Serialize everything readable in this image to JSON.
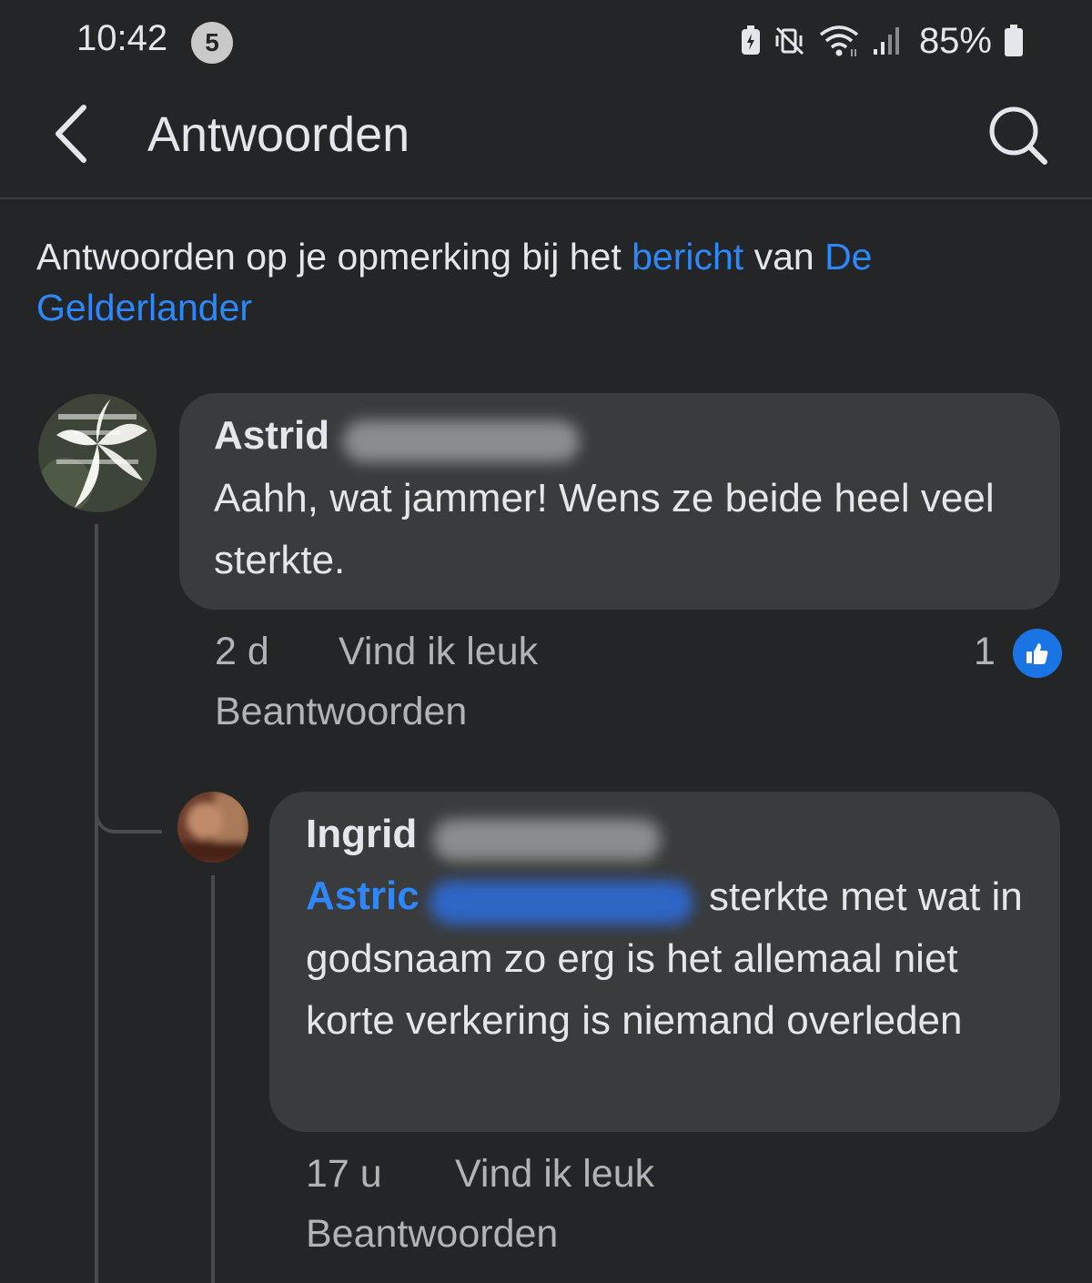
{
  "status_bar": {
    "time": "10:42",
    "notification_count": "5",
    "battery_percent": "85%"
  },
  "header": {
    "title": "Antwoorden"
  },
  "intro": {
    "text_before": "Antwoorden op je opmerking bij het ",
    "link_post": "bericht",
    "text_middle": " van ",
    "link_page": "De Gelderlander"
  },
  "comments": [
    {
      "author_first": "Astrid",
      "text": "Aahh, wat jammer! Wens ze beide heel veel sterkte.",
      "age": "2 d",
      "like_label": "Vind ik leuk",
      "reply_label": "Beantwoorden",
      "like_count": "1",
      "avatar_icon": "lily-flower-avatar"
    },
    {
      "author_first": "Ingrid",
      "mention_first": "Astric",
      "text": "sterkte met wat in godsnaam zo erg is het allemaal niet korte verkering is niemand overleden",
      "age": "17 u",
      "like_label": "Vind ik leuk",
      "reply_label": "Beantwoorden",
      "avatar_icon": "blurred-avatar"
    }
  ],
  "colors": {
    "background": "#242526",
    "bubble": "#3a3b3c",
    "link": "#2d88ff",
    "like_badge": "#1b74e4"
  }
}
